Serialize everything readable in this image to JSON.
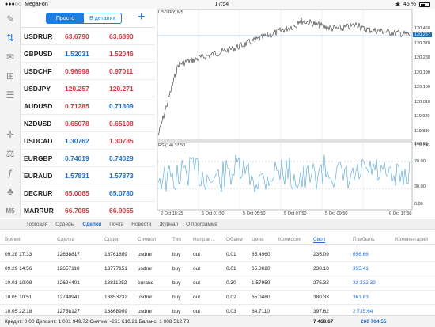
{
  "status": {
    "carrier": "MegaFon",
    "time": "17:54",
    "battery": "45 %"
  },
  "sidebar": {
    "m5": "M5"
  },
  "quotes_header": {
    "tab_simple": "Просто",
    "tab_detail": "В деталях",
    "add": "+"
  },
  "quotes": [
    {
      "symbol": "USDRUR",
      "bid": "63.6790",
      "ask": "63.6890",
      "bid_color": "red",
      "ask_color": "red"
    },
    {
      "symbol": "GBPUSD",
      "bid": "1.52031",
      "ask": "1.52046",
      "bid_color": "blue",
      "ask_color": "red"
    },
    {
      "symbol": "USDCHF",
      "bid": "0.96998",
      "ask": "0.97011",
      "bid_color": "red",
      "ask_color": "red"
    },
    {
      "symbol": "USDJPY",
      "bid": "120.257",
      "ask": "120.271",
      "bid_color": "red",
      "ask_color": "red"
    },
    {
      "symbol": "AUDUSD",
      "bid": "0.71285",
      "ask": "0.71309",
      "bid_color": "red",
      "ask_color": "blue"
    },
    {
      "symbol": "NZDUSD",
      "bid": "0.65078",
      "ask": "0.65108",
      "bid_color": "red",
      "ask_color": "red"
    },
    {
      "symbol": "USDCAD",
      "bid": "1.30762",
      "ask": "1.30785",
      "bid_color": "blue",
      "ask_color": "red"
    },
    {
      "symbol": "EURGBP",
      "bid": "0.74019",
      "ask": "0.74029",
      "bid_color": "blue",
      "ask_color": "blue"
    },
    {
      "symbol": "EURAUD",
      "bid": "1.57831",
      "ask": "1.57873",
      "bid_color": "blue",
      "ask_color": "blue"
    },
    {
      "symbol": "DECRUR",
      "bid": "65.0065",
      "ask": "65.0780",
      "bid_color": "red",
      "ask_color": "blue"
    },
    {
      "symbol": "MARRUR",
      "bid": "66.7085",
      "ask": "66.9055",
      "bid_color": "red",
      "ask_color": "red"
    }
  ],
  "chart": {
    "title": "USDJPY, M5",
    "rsi_title": "RSI(14) 37.50",
    "price_tag": "120.257",
    "y_labels": [
      "120.460",
      "120.370",
      "120.280",
      "120.190",
      "120.100",
      "120.010",
      "119.920",
      "119.830",
      "119.740"
    ],
    "rsi_labels": [
      "100.00",
      "70.00",
      "30.00",
      "0.00"
    ],
    "x_labels": [
      "2 Oct 18:25",
      "5 Oct 01:50",
      "5 Oct 05:50",
      "5 Oct 07:50",
      "5 Oct 09:50",
      "6 Oct 17:50"
    ],
    "line_color": "#333333",
    "rsi_color": "#4aa3d8",
    "tag_color": "#1a6fb5"
  },
  "tabs": [
    "Торговля",
    "Ордеры",
    "Сделки",
    "Почта",
    "Новости",
    "Журнал",
    "О программе"
  ],
  "active_tab": "Сделки",
  "table": {
    "headers": [
      "Время",
      "Сделка",
      "Ордер",
      "Символ",
      "Тип",
      "Направ...",
      "Объем",
      "Цена",
      "Комиссия",
      "Своп",
      "Прибыль",
      "Комментарий"
    ],
    "rows": [
      [
        "09.28 17:33",
        "12638817",
        "13761809",
        "usdrur",
        "buy",
        "out",
        "0.01",
        "65.4960",
        "",
        "235.09",
        "656.66",
        ""
      ],
      [
        "09.29 14:56",
        "12657110",
        "13777151",
        "usdrur",
        "buy",
        "out",
        "0.01",
        "65.8020",
        "",
        "238.18",
        "355.41",
        ""
      ],
      [
        "10.01 10:08",
        "12694401",
        "13811252",
        "euraud",
        "buy",
        "out",
        "0.30",
        "1.57959",
        "",
        "275.32",
        "32 232.39",
        ""
      ],
      [
        "10.05 10:51",
        "12740941",
        "13853232",
        "usdrur",
        "buy",
        "out",
        "0.02",
        "65.0480",
        "",
        "380.33",
        "361.83",
        ""
      ],
      [
        "10.05 22:18",
        "12758127",
        "13868909",
        "usdrur",
        "buy",
        "out",
        "0.03",
        "64.7110",
        "",
        "397.62",
        "2 735.64",
        ""
      ]
    ]
  },
  "footer": {
    "summary": "Кредит: 0.00 Депозит: 1 001 949.72 Снятие: -261 610.21 Баланс: 1 008 512.73",
    "swap_total": "7 468.67",
    "profit_total": "260 704.55"
  }
}
